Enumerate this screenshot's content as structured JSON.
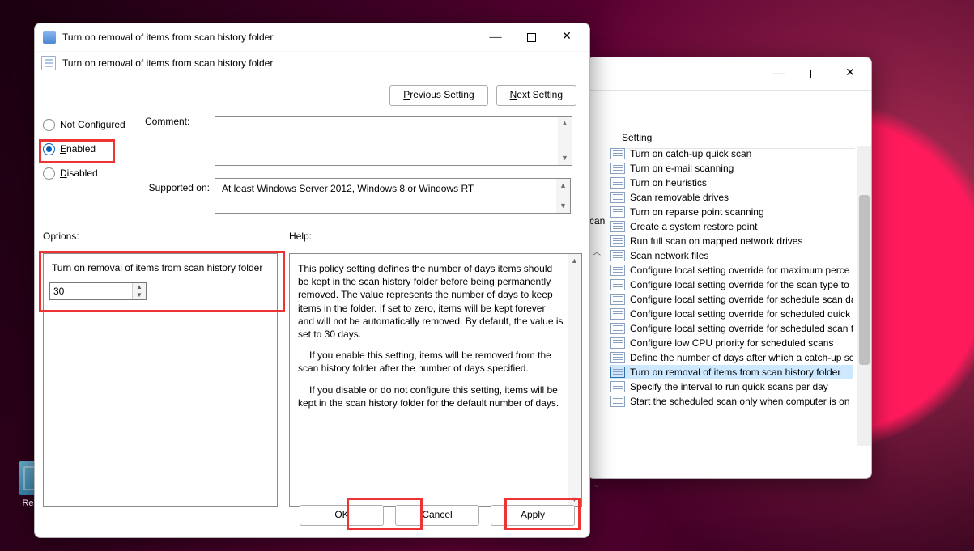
{
  "desktop": {
    "recycle_bin_label": "Recycl"
  },
  "back_window": {
    "column_header": "Setting",
    "can_label": "can",
    "items": [
      "Turn on catch-up quick scan",
      "Turn on e-mail scanning",
      "Turn on heuristics",
      "Scan removable drives",
      "Turn on reparse point scanning",
      "Create a system restore point",
      "Run full scan on mapped network drives",
      "Scan network files",
      "Configure local setting override for maximum perce",
      "Configure local setting override for the scan type to",
      "Configure local setting override for schedule scan da",
      "Configure local setting override for scheduled quick",
      "Configure local setting override for scheduled scan t",
      "Configure low CPU priority for scheduled scans",
      "Define the number of days after which a catch-up sc",
      "Turn on removal of items from scan history folder",
      "Specify the interval to run quick scans per day",
      "Start the scheduled scan only when computer is on k"
    ],
    "selected_index": 15
  },
  "policy": {
    "title": "Turn on removal of items from scan history folder",
    "subtitle": "Turn on removal of items from scan history folder",
    "nav": {
      "prev": "Previous Setting",
      "next": "Next Setting",
      "prev_u": "P",
      "next_u": "N"
    },
    "radios": {
      "not_configured": "Not Configured",
      "enabled": "Enabled",
      "disabled": "Disabled",
      "selected": "enabled",
      "nc_u": "C",
      "en_u": "E",
      "ds_u": "D"
    },
    "comment_label": "Comment:",
    "comment_value": "",
    "supported_label": "Supported on:",
    "supported_value": "At least Windows Server 2012, Windows 8 or Windows RT",
    "options_label": "Options:",
    "help_label": "Help:",
    "option_caption": "Turn on removal of items from scan history folder",
    "option_value": "30",
    "help_text_p1": "This policy setting defines the number of days items should be kept in the scan history folder before being permanently removed. The value represents the number of days to keep items in the folder. If set to zero, items will be kept forever and will not be automatically removed. By default, the value is set to 30 days.",
    "help_text_p2": "If you enable this setting, items will be removed from the scan history folder after the number of days specified.",
    "help_text_p3": "If you disable or do not configure this setting, items will be kept in the scan history folder for the default number of days.",
    "buttons": {
      "ok": "OK",
      "cancel": "Cancel",
      "apply": "Apply",
      "apply_u": "A"
    }
  }
}
